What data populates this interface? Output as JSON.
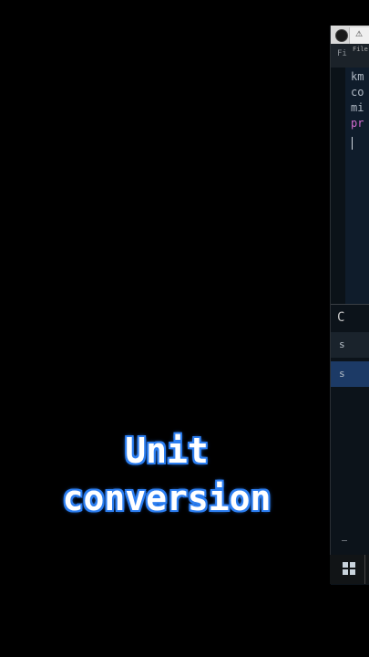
{
  "window": {
    "menu_file": "File",
    "menu_left": "Fi",
    "tab_icon": "⚠"
  },
  "editor": {
    "lines": [
      {
        "text": "km",
        "color": "#aeb7c2"
      },
      {
        "text": "co",
        "color": "#aeb7c2"
      },
      {
        "text": "mi",
        "color": "#aeb7c2"
      },
      {
        "text": "pr",
        "color": "#d46cd0"
      }
    ]
  },
  "console": {
    "header": "C",
    "strip1": "s",
    "strip2": "s"
  },
  "caption": {
    "line1": "Unit",
    "line2": "conversion"
  },
  "colors": {
    "caption_glow": "#2e7ff0",
    "keyword": "#d46cd0"
  }
}
